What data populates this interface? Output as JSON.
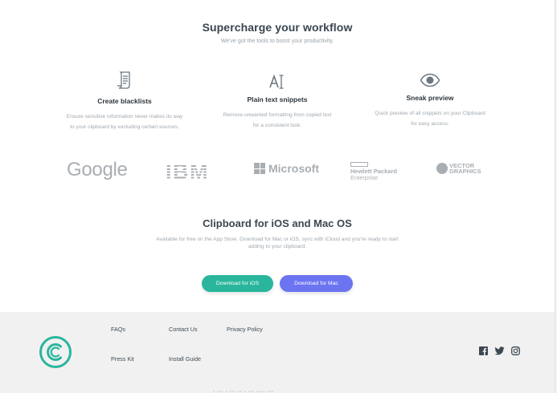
{
  "hero": {
    "title": "Supercharge your workflow",
    "subtitle": "We've got the tools to boost your productivity."
  },
  "features": [
    {
      "icon": "document-list-icon",
      "name": "Create blacklists",
      "desc_line1": "Ensure sensitive information never makes its way",
      "desc_line2": "to your clipboard by excluding certain sources."
    },
    {
      "icon": "text-format-icon",
      "name": "Plain text snippets",
      "desc_line1": "Remove unwanted formatting from copied text",
      "desc_line2": "for a consistent look."
    },
    {
      "icon": "eye-icon",
      "name": "Sneak preview",
      "desc_line1": "Quick preview of all snippets on your Clipboard",
      "desc_line2": "for easy access."
    }
  ],
  "logos": {
    "google": "Google",
    "ibm": "IBM",
    "microsoft": "Microsoft",
    "hpe_line1": "Hewlett Packard",
    "hpe_line2": "Enterprise",
    "vector_line1": "VECTOR",
    "vector_line2": "GRAPHICS"
  },
  "cta": {
    "title": "Clipboard for iOS and Mac OS",
    "desc": "Available for free on the App Store. Download for Mac or iOS, sync with iCloud and you're ready to start adding to your clipboard.",
    "ios_button": "Download for iOS",
    "mac_button": "Download for Mac"
  },
  "footer": {
    "links": {
      "faqs": "FAQs",
      "contact": "Contact Us",
      "privacy": "Privacy Policy",
      "press": "Press Kit",
      "install": "Install Guide"
    },
    "social": [
      "facebook-icon",
      "twitter-icon",
      "instagram-icon"
    ]
  },
  "colors": {
    "teal": "#29b69c",
    "indigo": "#6c74f2",
    "footer_bg": "#f1f1f1",
    "logo_gray": "#a9aeb3"
  }
}
